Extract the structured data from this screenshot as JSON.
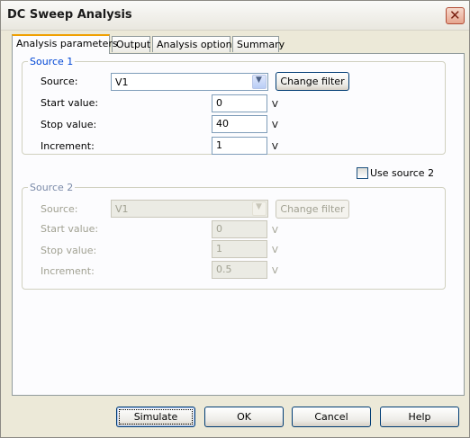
{
  "window": {
    "title": "DC Sweep Analysis"
  },
  "tabs": [
    {
      "label": "Analysis parameters"
    },
    {
      "label": "Output"
    },
    {
      "label": "Analysis options"
    },
    {
      "label": "Summary"
    }
  ],
  "source1": {
    "legend": "Source 1",
    "source_label": "Source:",
    "source_value": "V1",
    "change_filter": "Change filter",
    "start_label": "Start value:",
    "start_value": "0",
    "stop_label": "Stop value:",
    "stop_value": "40",
    "increment_label": "Increment:",
    "increment_value": "1",
    "unit": "V"
  },
  "use_source2": {
    "label": "Use source 2",
    "checked": false
  },
  "source2": {
    "legend": "Source 2",
    "source_label": "Source:",
    "source_value": "V1",
    "change_filter": "Change filter",
    "start_label": "Start value:",
    "start_value": "0",
    "stop_label": "Stop value:",
    "stop_value": "1",
    "increment_label": "Increment:",
    "increment_value": "0.5",
    "unit": "V"
  },
  "buttons": {
    "simulate": "Simulate",
    "ok": "OK",
    "cancel": "Cancel",
    "help": "Help"
  },
  "icons": {
    "close": "close-icon",
    "dropdown": "chevron-down-icon"
  }
}
